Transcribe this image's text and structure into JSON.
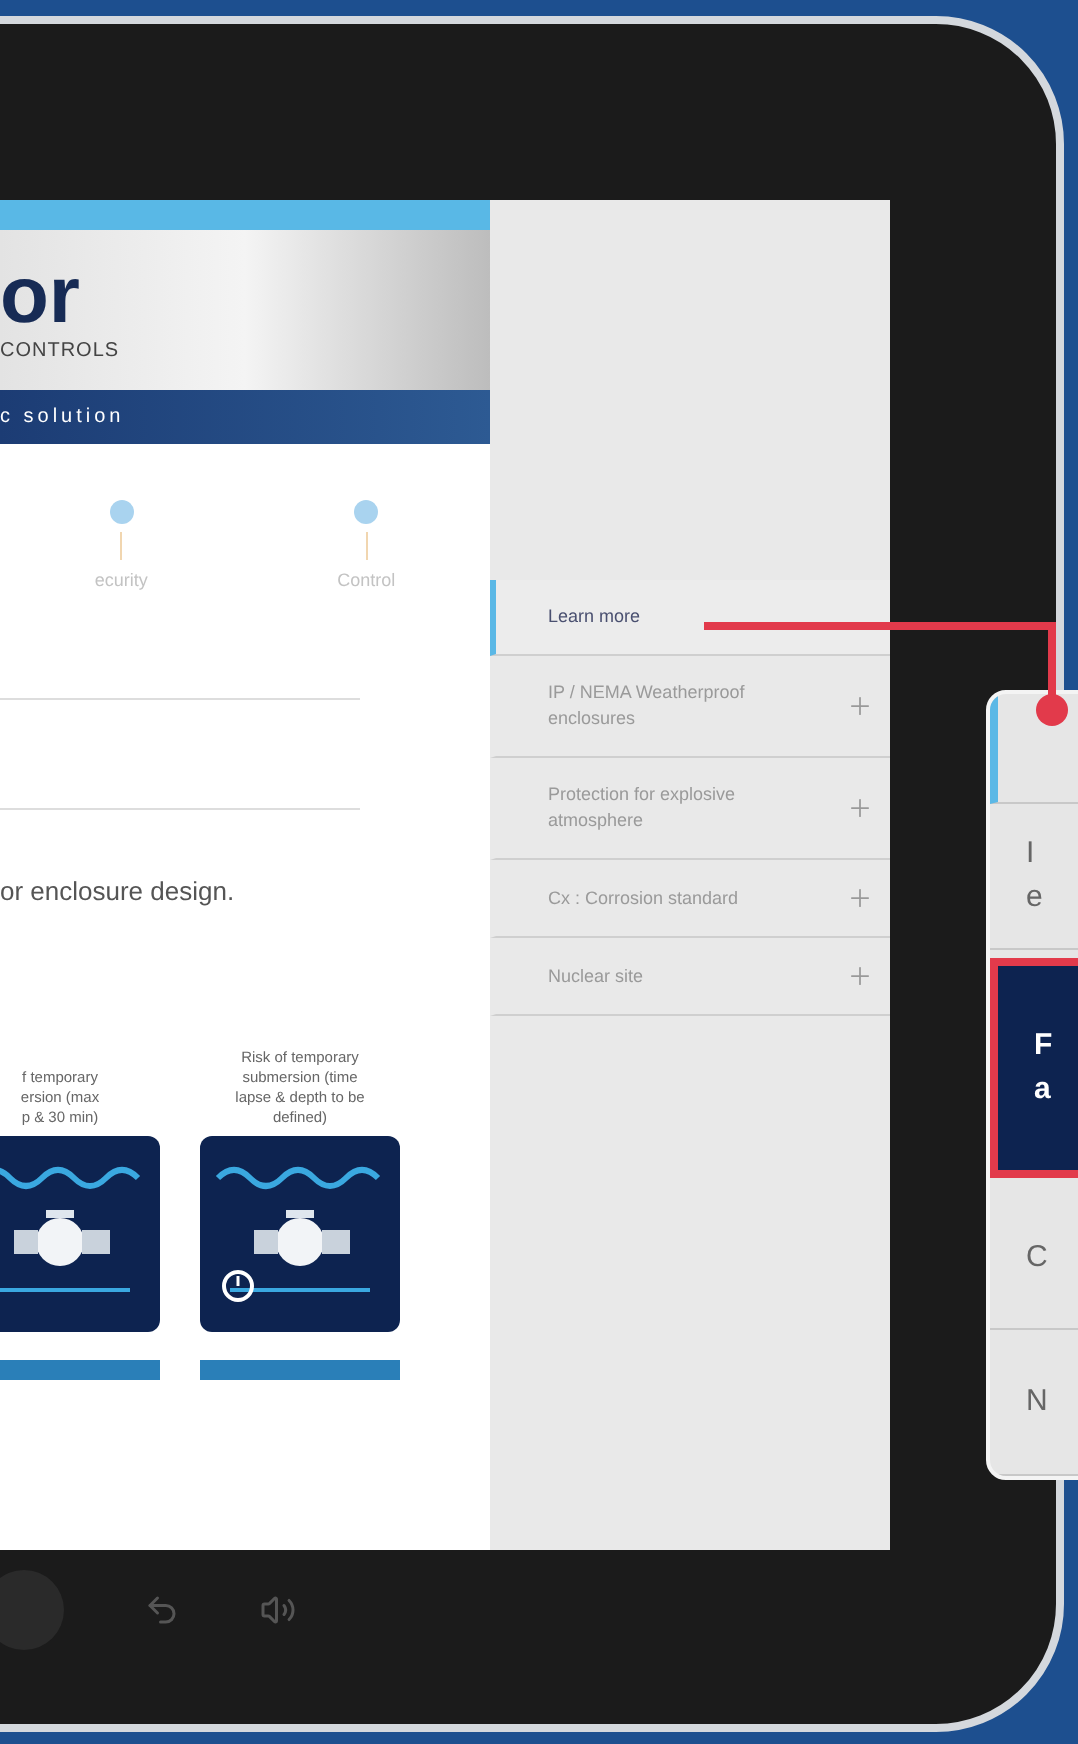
{
  "header": {
    "logo_text": "or",
    "logo_subtitle": "CONTROLS",
    "banner": "c solution"
  },
  "steps": [
    {
      "label": "ecurity"
    },
    {
      "label": "Control"
    }
  ],
  "intro": "or enclosure design.",
  "cards": [
    {
      "kind": "submersion",
      "caption": [
        "f temporary",
        "ersion (max",
        "p & 30 min)"
      ]
    },
    {
      "kind": "timed",
      "caption": [
        "Risk of temporary",
        "submersion (time",
        "lapse & depth to be",
        "defined)"
      ]
    }
  ],
  "sidebar": {
    "items": [
      {
        "label": "Learn more",
        "selected": true,
        "expandable": false
      },
      {
        "label": "IP / NEMA Weatherproof enclosures",
        "selected": false,
        "expandable": true
      },
      {
        "label": "Protection for explosive atmosphere",
        "selected": false,
        "expandable": true
      },
      {
        "label": "Cx : Corrosion standard",
        "selected": false,
        "expandable": true
      },
      {
        "label": "Nuclear site",
        "selected": false,
        "expandable": true
      }
    ]
  },
  "callout": {
    "items": [
      {
        "lines": [
          "I",
          "e"
        ],
        "selected": false
      },
      {
        "lines": [
          "F",
          "a"
        ],
        "selected": true
      },
      {
        "lines": [
          "C"
        ],
        "selected": false
      },
      {
        "lines": [
          "N"
        ],
        "selected": false
      }
    ]
  }
}
